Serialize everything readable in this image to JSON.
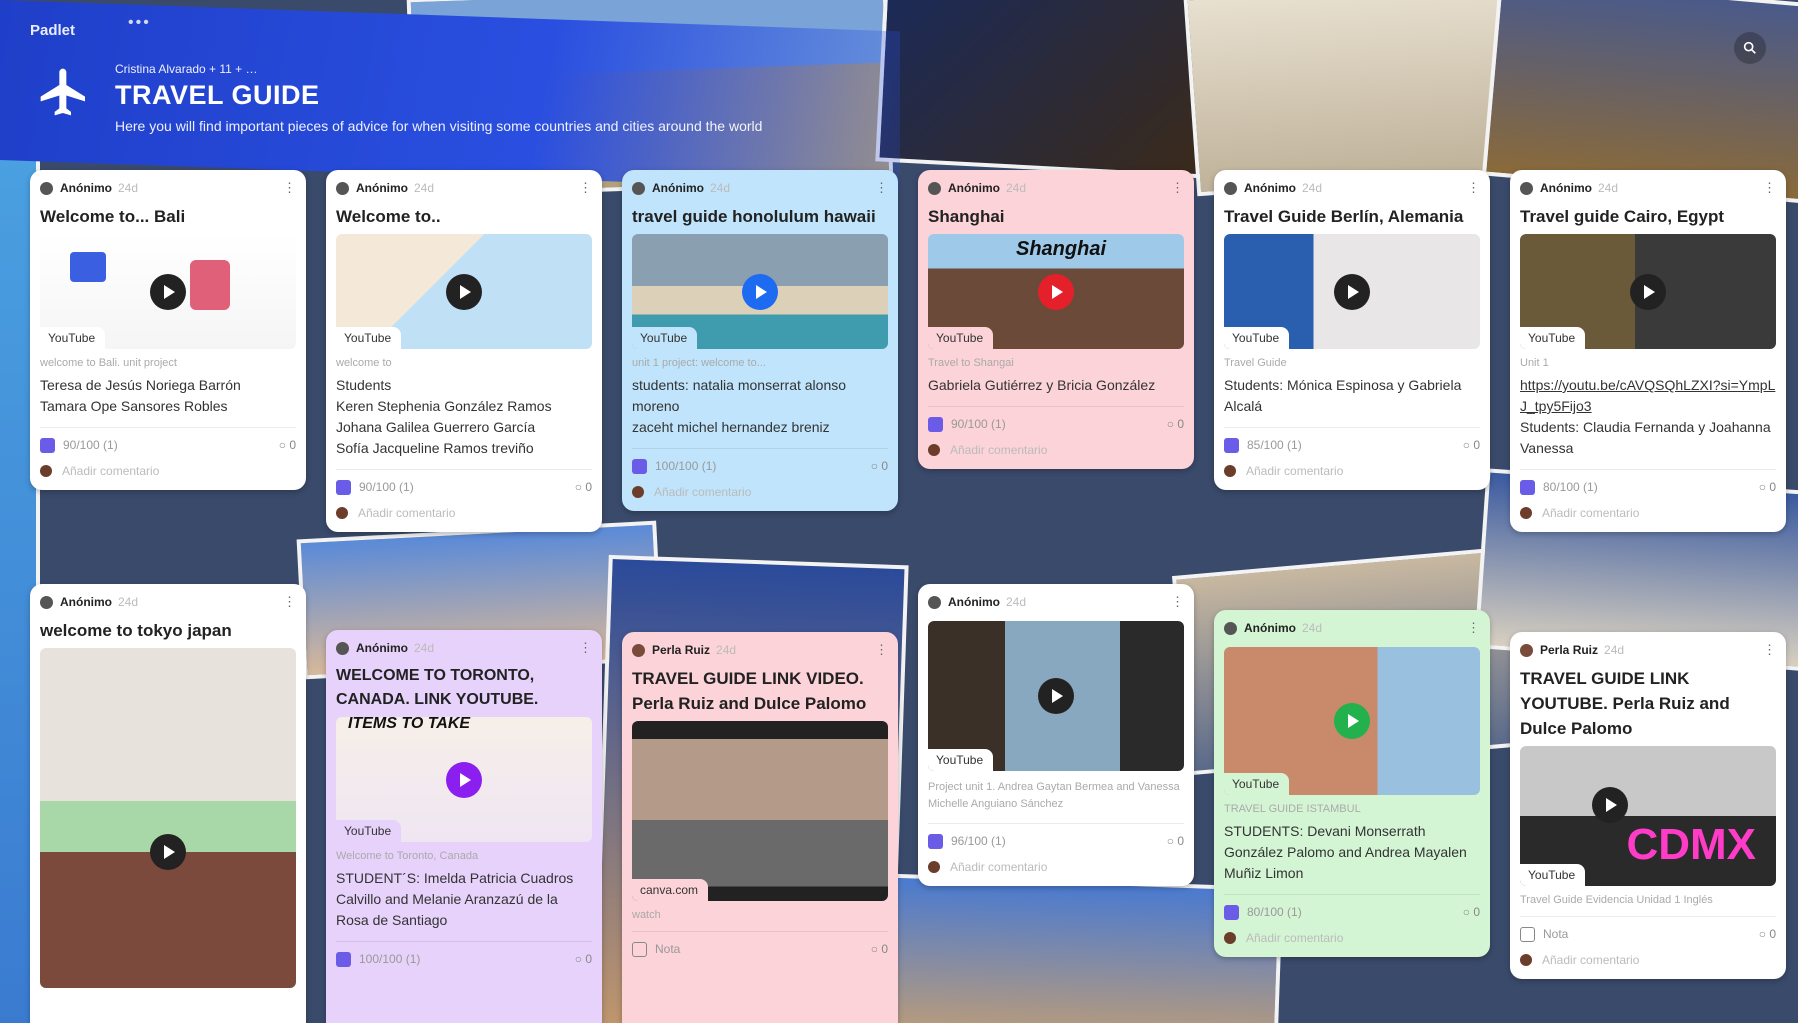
{
  "header": {
    "brand": "Padlet",
    "dots": "•••",
    "authors": "Cristina Alvarado + 11 + …",
    "title": "TRAVEL GUIDE",
    "subtitle": "Here you will find important pieces of advice for when visiting some countries and cities around the world"
  },
  "colors": {
    "accent": "#2a4fe0",
    "check": "#6b5ce7"
  },
  "common": {
    "youtube": "YouTube",
    "add_comment": "Añadir comentario",
    "anon": "Anónimo",
    "time": "24d",
    "menu": "⋮",
    "note_label": "Nota"
  },
  "cards": [
    {
      "title": "Welcome to... Bali",
      "caption": "welcome to Bali. unit project",
      "body": "Teresa de Jesús Noriega Barrón\nTamara Ope Sansores Robles",
      "score": "90/100 (1)",
      "comments": "0"
    },
    {
      "title": "Welcome to..",
      "caption": "welcome to",
      "body": "Students\nKeren Stephenia González Ramos\nJohana Galilea Guerrero García\nSofía Jacqueline Ramos treviño",
      "score": "90/100 (1)",
      "comments": "0"
    },
    {
      "title": "travel guide honolulum hawaii",
      "caption": "unit 1 project: welcome to...",
      "body": "students: natalia monserrat alonso moreno\nzaceht michel hernandez breniz",
      "score": "100/100 (1)",
      "comments": "0"
    },
    {
      "title": "Shanghai",
      "media_text": "Shanghai",
      "caption": "Travel to Shangai",
      "body": "Gabriela Gutiérrez y Bricia González",
      "score": "90/100 (1)",
      "comments": "0"
    },
    {
      "title": "Travel Guide Berlín, Alemania",
      "caption": "Travel Guide",
      "body": "Students: Mónica Espinosa y Gabriela Alcalá",
      "score": "85/100 (1)",
      "comments": "0"
    },
    {
      "title": "Travel guide Cairo, Egypt",
      "caption": "Unit 1",
      "link": "https://youtu.be/cAVQSQhLZXI?si=YmpLJ_tpy5Fijo3",
      "body": "Students: Claudia Fernanda y Joahanna Vanessa",
      "score": "80/100 (1)",
      "comments": "0"
    },
    {
      "title": "welcome to tokyo japan"
    },
    {
      "title": "WELCOME TO TORONTO, CANADA. LINK YOUTUBE.",
      "media_text": "ITEMS TO TAKE",
      "caption": "Welcome to Toronto, Canada",
      "body": "STUDENT´S: Imelda Patricia Cuadros Calvillo and Melanie Aranzazú de la Rosa de Santiago",
      "score": "100/100 (1)",
      "comments": "0"
    },
    {
      "author": "Perla Ruiz",
      "title": "TRAVEL GUIDE LINK VIDEO. Perla Ruiz and Dulce Palomo",
      "source": "canva.com",
      "caption": "watch",
      "comments": "0"
    },
    {
      "caption": "Project unit 1. Andrea Gaytan Bermea and Vanessa Michelle Anguiano Sánchez",
      "score": "96/100 (1)",
      "comments": "0"
    },
    {
      "caption": "TRAVEL GUIDE ISTAMBUL",
      "body": "STUDENTS: Devani Monserrath González Palomo and Andrea Mayalen Muñiz Limon",
      "score": "80/100 (1)",
      "comments": "0"
    },
    {
      "author": "Perla Ruiz",
      "title": "TRAVEL GUIDE LINK YOUTUBE. Perla Ruiz and Dulce Palomo",
      "media_text": "CDMX",
      "caption": "Travel Guide Evidencia Unidad 1 Inglés",
      "comments": "0"
    }
  ]
}
